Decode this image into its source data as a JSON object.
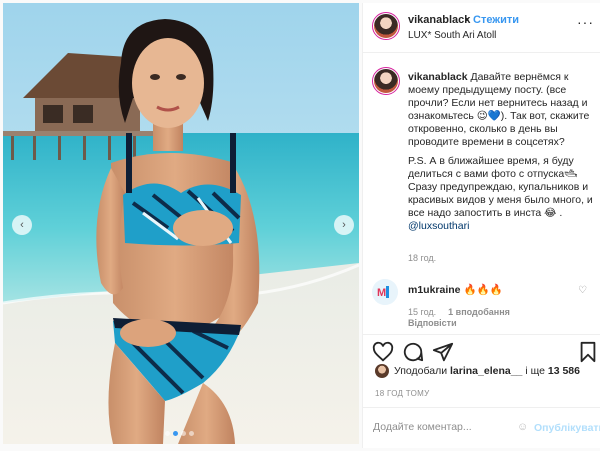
{
  "header": {
    "username": "vikanablack",
    "separator": "•",
    "follow_label": "Стежити",
    "location": "LUX* South Ari Atoll",
    "more_label": "···"
  },
  "photo": {
    "prev_label": "‹",
    "next_label": "›",
    "slides": 4,
    "active_slide": 2
  },
  "caption": {
    "username": "vikanablack",
    "line1": "Давайте вернёмся к моему предыдущему посту. (все прочли? Если нет вернитесь назад и ознакомьтесь 😉💙). Так вот, скажите откровенно, сколько в день вы проводите времени в соцсетях?",
    "line2": "P.S. А в ближайшее время, я буду делиться с вами фото с отпуска🛥 Сразу предупреждаю, купальников и красивых видов у меня было много, и все надо запостить в инста 😂 .",
    "mention": "@luxsouthari",
    "time": "18 год."
  },
  "comment": {
    "username": "m1ukraine",
    "text": "🔥🔥🔥",
    "time": "15 год.",
    "likes": "1 вподобання",
    "reply": "Відповісти"
  },
  "actions": {
    "like_icon": "heart-outline",
    "comment_icon": "speech-bubble",
    "share_icon": "paper-plane",
    "save_icon": "bookmark"
  },
  "likes": {
    "prefix": "Уподобали",
    "user": "larina_elena__",
    "suffix": "і ще",
    "count": "13 586"
  },
  "post_time": "18 ГОД ТОМУ",
  "comment_box": {
    "placeholder": "Додайте коментар...",
    "emoji": "☺",
    "post_label": "Опублікувати"
  },
  "colors": {
    "accent": "#3897f0",
    "muted": "#8e8e8e",
    "border": "#efefef"
  }
}
